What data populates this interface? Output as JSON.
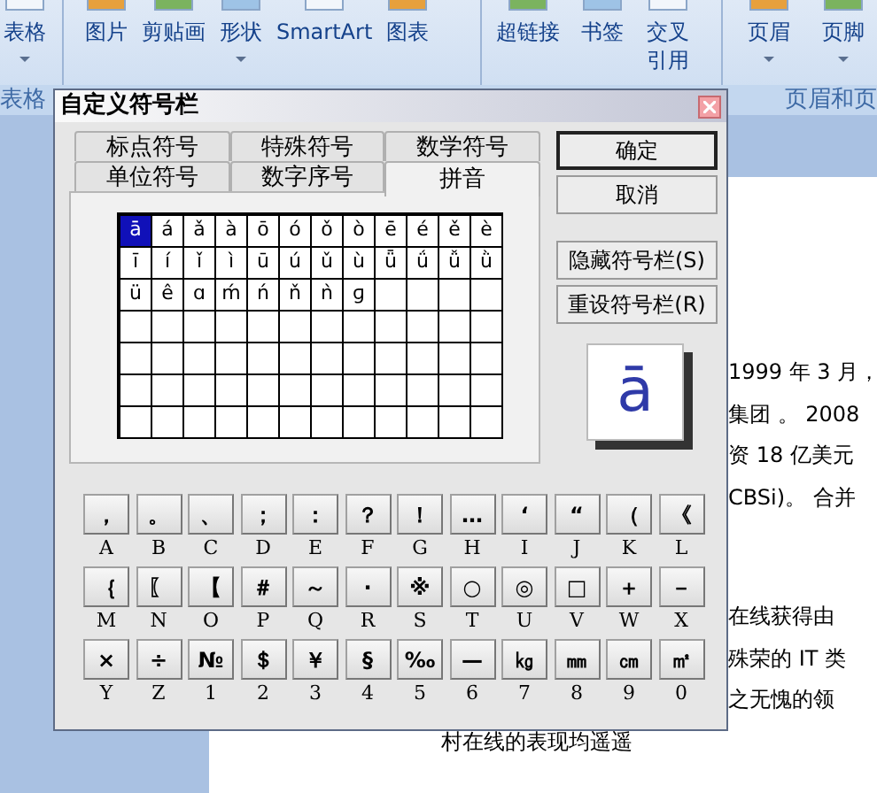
{
  "ribbon": {
    "groups": [
      {
        "label": "表格",
        "buttons": [
          {
            "label": "表格",
            "dropdown": true
          }
        ]
      },
      {
        "buttons": [
          {
            "label": "图片",
            "dropdown": false
          },
          {
            "label": "剪贴画",
            "dropdown": false
          },
          {
            "label": "形状",
            "dropdown": true
          },
          {
            "label": "SmartArt",
            "dropdown": false
          },
          {
            "label": "图表",
            "dropdown": false
          }
        ]
      },
      {
        "buttons": [
          {
            "label": "超链接",
            "dropdown": false
          },
          {
            "label": "书签",
            "dropdown": false
          },
          {
            "label": "交叉引用",
            "dropdown": false
          }
        ]
      },
      {
        "label": "页眉和页",
        "buttons": [
          {
            "label": "页眉",
            "dropdown": true
          },
          {
            "label": "页脚",
            "dropdown": true
          }
        ]
      }
    ]
  },
  "document": {
    "paragraphs": [
      [
        "1999 年 3 月，",
        "集团 。 2008",
        "资 18 亿美元",
        "CBSi)。 合并"
      ],
      [
        "在线获得由",
        "殊荣的 IT 类",
        "之无愧的领"
      ]
    ],
    "last_line": "村在线的表现均遥遥"
  },
  "dialog": {
    "title": "自定义符号栏",
    "tab_rows": [
      [
        {
          "label": "标点符号",
          "selected": false
        },
        {
          "label": "特殊符号",
          "selected": false
        },
        {
          "label": "数学符号",
          "selected": false
        }
      ],
      [
        {
          "label": "单位符号",
          "selected": false
        },
        {
          "label": "数字序号",
          "selected": false
        },
        {
          "label": "拼音",
          "selected": true
        }
      ]
    ],
    "cells": [
      {
        "symbol": "ā",
        "selected": true
      },
      {
        "symbol": "á",
        "selected": false
      },
      {
        "symbol": "ǎ",
        "selected": false
      },
      {
        "symbol": "à",
        "selected": false
      },
      {
        "symbol": "ō",
        "selected": false
      },
      {
        "symbol": "ó",
        "selected": false
      },
      {
        "symbol": "ǒ",
        "selected": false
      },
      {
        "symbol": "ò",
        "selected": false
      },
      {
        "symbol": "ē",
        "selected": false
      },
      {
        "symbol": "é",
        "selected": false
      },
      {
        "symbol": "ě",
        "selected": false
      },
      {
        "symbol": "è",
        "selected": false
      },
      {
        "symbol": "ī",
        "selected": false
      },
      {
        "symbol": "í",
        "selected": false
      },
      {
        "symbol": "ǐ",
        "selected": false
      },
      {
        "symbol": "ì",
        "selected": false
      },
      {
        "symbol": "ū",
        "selected": false
      },
      {
        "symbol": "ú",
        "selected": false
      },
      {
        "symbol": "ǔ",
        "selected": false
      },
      {
        "symbol": "ù",
        "selected": false
      },
      {
        "symbol": "ǖ",
        "selected": false
      },
      {
        "symbol": "ǘ",
        "selected": false
      },
      {
        "symbol": "ǚ",
        "selected": false
      },
      {
        "symbol": "ǜ",
        "selected": false
      },
      {
        "symbol": "ü",
        "selected": false
      },
      {
        "symbol": "ê",
        "selected": false
      },
      {
        "symbol": "ɑ",
        "selected": false
      },
      {
        "symbol": "ḿ",
        "selected": false
      },
      {
        "symbol": "ń",
        "selected": false
      },
      {
        "symbol": "ň",
        "selected": false
      },
      {
        "symbol": "ǹ",
        "selected": false
      },
      {
        "symbol": "ɡ",
        "selected": false
      }
    ],
    "buttons": [
      {
        "label": "确定",
        "default": true
      },
      {
        "label": "取消",
        "default": false
      }
    ],
    "bar_buttons": [
      {
        "label": "隐藏符号栏(S)"
      },
      {
        "label": "重设符号栏(R)"
      }
    ],
    "preview": "ā",
    "keys": [
      [
        {
          "symbol": "，",
          "key": "A"
        },
        {
          "symbol": "。",
          "key": "B"
        },
        {
          "symbol": "、",
          "key": "C"
        },
        {
          "symbol": "；",
          "key": "D"
        },
        {
          "symbol": "：",
          "key": "E"
        },
        {
          "symbol": "？",
          "key": "F"
        },
        {
          "symbol": "！",
          "key": "G"
        },
        {
          "symbol": "…",
          "key": "H"
        },
        {
          "symbol": "‘",
          "key": "I"
        },
        {
          "symbol": "“",
          "key": "J"
        },
        {
          "symbol": "（",
          "key": "K"
        },
        {
          "symbol": "《",
          "key": "L"
        }
      ],
      [
        {
          "symbol": "｛",
          "key": "M"
        },
        {
          "symbol": "〖",
          "key": "N"
        },
        {
          "symbol": "【",
          "key": "O"
        },
        {
          "symbol": "＃",
          "key": "P"
        },
        {
          "symbol": "～",
          "key": "Q"
        },
        {
          "symbol": "·",
          "key": "R"
        },
        {
          "symbol": "※",
          "key": "S"
        },
        {
          "symbol": "○",
          "key": "T"
        },
        {
          "symbol": "◎",
          "key": "U"
        },
        {
          "symbol": "□",
          "key": "V"
        },
        {
          "symbol": "＋",
          "key": "W"
        },
        {
          "symbol": "－",
          "key": "X"
        }
      ],
      [
        {
          "symbol": "×",
          "key": "Y"
        },
        {
          "symbol": "÷",
          "key": "Z"
        },
        {
          "symbol": "№",
          "key": "1"
        },
        {
          "symbol": "＄",
          "key": "2"
        },
        {
          "symbol": "￥",
          "key": "3"
        },
        {
          "symbol": "§",
          "key": "4"
        },
        {
          "symbol": "‰",
          "key": "5"
        },
        {
          "symbol": "—",
          "key": "6"
        },
        {
          "symbol": "㎏",
          "key": "7"
        },
        {
          "symbol": "㎜",
          "key": "8"
        },
        {
          "symbol": "㎝",
          "key": "9"
        },
        {
          "symbol": "㎡",
          "key": "0"
        }
      ]
    ]
  }
}
